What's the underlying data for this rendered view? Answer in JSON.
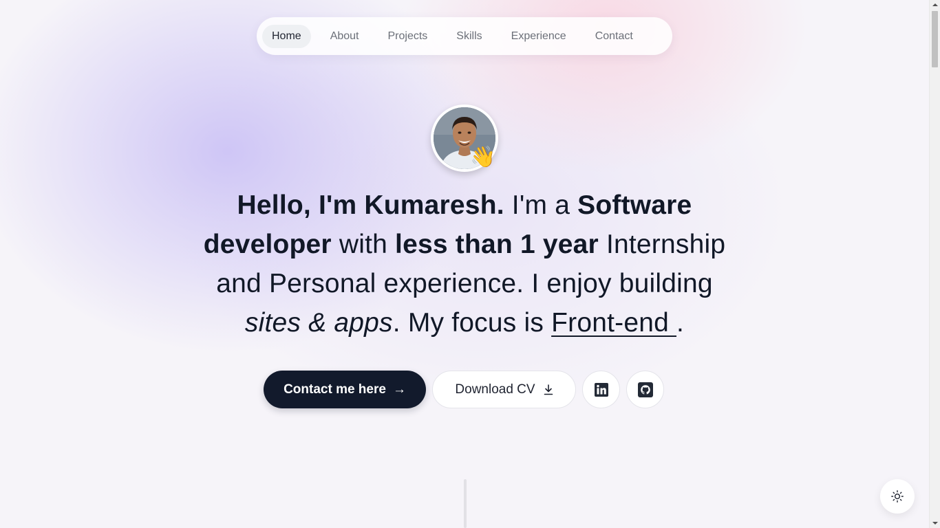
{
  "nav": {
    "items": [
      {
        "label": "Home",
        "active": true
      },
      {
        "label": "About"
      },
      {
        "label": "Projects"
      },
      {
        "label": "Skills"
      },
      {
        "label": "Experience"
      },
      {
        "label": "Contact"
      }
    ]
  },
  "hero": {
    "avatar_icon": "profile-photo",
    "wave_emoji": "👋",
    "headline": {
      "part1_bold": "Hello, I'm Kumaresh.",
      "part2": " I'm a ",
      "part3_bold": "Software developer",
      "part4": " with ",
      "part5_bold": "less than 1 year",
      "part6": " Internship and Personal experience. I enjoy building ",
      "part7_italic": "sites & apps",
      "part8": ". My focus is ",
      "part9_underline": "Front-end ",
      "part10": "."
    },
    "contact_button": "Contact me here",
    "contact_arrow": "→",
    "cv_button": "Download CV",
    "linkedin_icon": "linkedin-icon",
    "github_icon": "github-icon"
  },
  "theme_toggle_icon": "sun-icon",
  "colors": {
    "primary_dark": "#121a2c",
    "text": "#111827",
    "nav_text": "#6b6f78",
    "nav_active_bg": "#eef0f3"
  }
}
